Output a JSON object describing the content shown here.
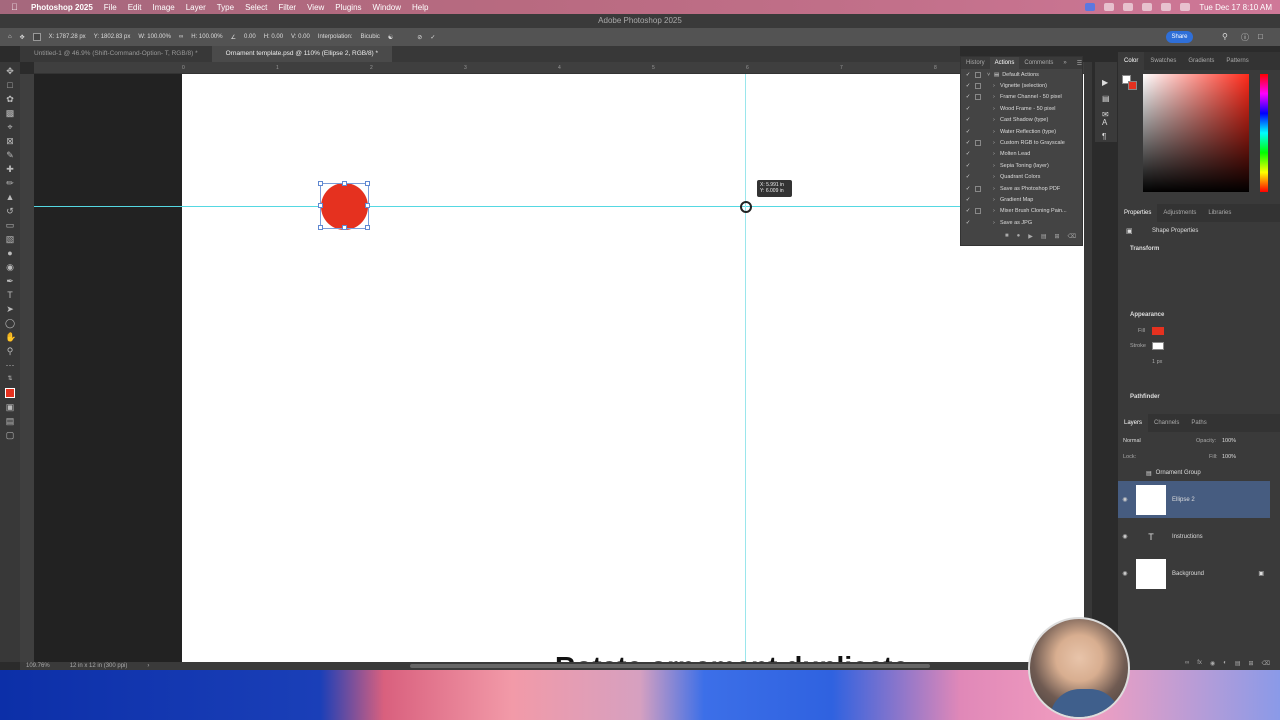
{
  "menubar": {
    "app_name": "Photoshop 2025",
    "items": [
      "File",
      "Edit",
      "Image",
      "Layer",
      "Type",
      "Select",
      "Filter",
      "View",
      "Plugins",
      "Window",
      "Help"
    ],
    "center_title": "Adobe Photoshop 2025",
    "clock": "Tue Dec 17  8:10 AM"
  },
  "options_bar": {
    "x": "X: 1787.28 px",
    "y": "Y: 1802.83 px",
    "w": "W: 100.00%",
    "h": "H: 100.00%",
    "angle": "0.00",
    "hskew": "H: 0.00",
    "vskew": "V: 0.00",
    "interpolation_label": "Interpolation:",
    "interpolation_value": "Bicubic",
    "share_label": "Share"
  },
  "tabs": [
    {
      "label": "Untitled-1 @ 46.9% (Shift-Command-Option- T, RGB/8) *"
    },
    {
      "label": "Ornament template.psd @ 110% (Ellipse 2, RGB/8) *"
    }
  ],
  "ruler_ticks": [
    "0",
    "1",
    "2",
    "3",
    "4",
    "5",
    "6",
    "7",
    "8"
  ],
  "canvas": {
    "tooltip_x": "X: 5.991 in",
    "tooltip_y": "Y: 6.009 in",
    "bottom_text": "Rotate ornament duplicate"
  },
  "actions_panel": {
    "tabs": [
      "History",
      "Actions",
      "Comments"
    ],
    "set_name": "Default Actions",
    "items": [
      {
        "label": "Vignette (selection)",
        "dialog": true
      },
      {
        "label": "Frame Channel - 50 pixel",
        "dialog": true
      },
      {
        "label": "Wood Frame - 50 pixel",
        "dialog": false
      },
      {
        "label": "Cast Shadow (type)",
        "dialog": false
      },
      {
        "label": "Water Reflection (type)",
        "dialog": false
      },
      {
        "label": "Custom RGB to Grayscale",
        "dialog": true
      },
      {
        "label": "Molten Lead",
        "dialog": false
      },
      {
        "label": "Sepia Toning (layer)",
        "dialog": false
      },
      {
        "label": "Quadrant Colors",
        "dialog": false
      },
      {
        "label": "Save as Photoshop PDF",
        "dialog": true
      },
      {
        "label": "Gradient Map",
        "dialog": false
      },
      {
        "label": "Mixer Brush Cloning Pain...",
        "dialog": true
      },
      {
        "label": "Save as JPG",
        "dialog": false
      }
    ]
  },
  "color_panel": {
    "tabs": [
      "Color",
      "Swatches",
      "Gradients",
      "Patterns"
    ],
    "foreground": "#ffffff",
    "background": "#e5311f"
  },
  "properties_panel": {
    "tabs": [
      "Properties",
      "Adjustments",
      "Libraries"
    ],
    "header": "Shape Properties",
    "transform_title": "Transform",
    "appearance_title": "Appearance",
    "fill_label": "Fill",
    "stroke_label": "Stroke",
    "stroke_size": "1 px",
    "pathfinder_title": "Pathfinder",
    "fill_color": "#e5311f"
  },
  "layers_panel": {
    "tabs": [
      "Layers",
      "Channels",
      "Paths"
    ],
    "blend_mode": "Normal",
    "opacity_label": "Opacity:",
    "opacity_value": "100%",
    "lock_label": "Lock:",
    "fill_label": "Fill:",
    "fill_value": "100%",
    "group_name": "Ornament Group",
    "layers": [
      {
        "name": "Ellipse 2",
        "selected": true
      },
      {
        "name": "Instructions",
        "selected": false
      },
      {
        "name": "Background",
        "selected": false
      }
    ]
  },
  "statusbar": {
    "zoom": "109.76%",
    "doc_info": "12 in x 12 in (300 ppi)"
  }
}
